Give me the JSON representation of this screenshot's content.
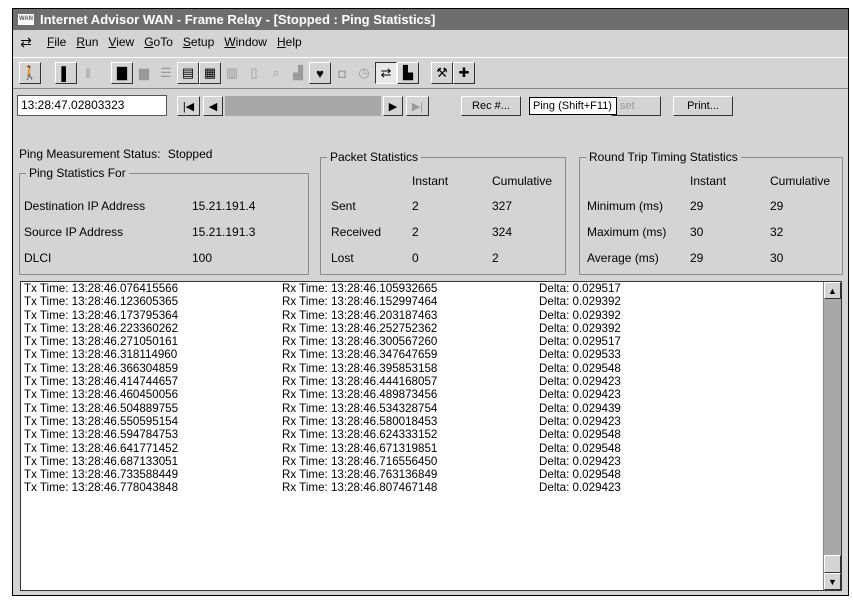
{
  "window": {
    "title": "Internet Advisor WAN - Frame Relay - [Stopped : Ping Statistics]",
    "icon_text": "WAN"
  },
  "menu": [
    "File",
    "Run",
    "View",
    "GoTo",
    "Setup",
    "Window",
    "Help"
  ],
  "toolbar": [
    {
      "icon": "walking-man-icon",
      "glyph": "🚶",
      "state": "on"
    },
    {
      "icon": "info-icon",
      "glyph": "▌",
      "state": "on"
    },
    {
      "icon": "pause-icon",
      "glyph": "‖",
      "state": "off"
    },
    {
      "icon": "bar-chart-icon",
      "glyph": "▇",
      "state": "on"
    },
    {
      "icon": "graph-icon",
      "glyph": "▆",
      "state": "off"
    },
    {
      "icon": "list-icon",
      "glyph": "☰",
      "state": "off"
    },
    {
      "icon": "table-icon",
      "glyph": "▤",
      "state": "on"
    },
    {
      "icon": "grid-icon",
      "glyph": "▦",
      "state": "on"
    },
    {
      "icon": "columns-icon",
      "glyph": "▥",
      "state": "off"
    },
    {
      "icon": "page-icon",
      "glyph": "▯",
      "state": "off"
    },
    {
      "icon": "search-icon",
      "glyph": "⌕",
      "state": "off"
    },
    {
      "icon": "stats-icon",
      "glyph": "▟",
      "state": "off"
    },
    {
      "icon": "heart-icon",
      "glyph": "♥",
      "state": "on"
    },
    {
      "icon": "cup-icon",
      "glyph": "◘",
      "state": "off"
    },
    {
      "icon": "clock-icon",
      "glyph": "◷",
      "state": "off"
    },
    {
      "icon": "ping-icon",
      "glyph": "⇄",
      "state": "pressed"
    },
    {
      "icon": "chart-icon",
      "glyph": "▙",
      "state": "on"
    },
    {
      "icon": "tools-icon",
      "glyph": "⚒",
      "state": "on"
    },
    {
      "icon": "plus-icon",
      "glyph": "✚",
      "state": "on"
    }
  ],
  "nav": {
    "time": "13:28:47.02803323",
    "rec_label": "Rec #...",
    "tooltip": "Ping (Shift+F11)",
    "reset_partial": "set",
    "print_label": "Print..."
  },
  "status": {
    "label": "Ping Measurement Status:",
    "value": "Stopped"
  },
  "ping_for": {
    "title": "Ping Statistics For",
    "rows": [
      {
        "label": "Destination IP Address",
        "value": "15.21.191.4"
      },
      {
        "label": "Source IP Address",
        "value": "15.21.191.3"
      },
      {
        "label": "DLCI",
        "value": "100"
      }
    ]
  },
  "packet_stats": {
    "title": "Packet Statistics",
    "headers": [
      "Instant",
      "Cumulative"
    ],
    "rows": [
      {
        "label": "Sent",
        "instant": "2",
        "cumulative": "327"
      },
      {
        "label": "Received",
        "instant": "2",
        "cumulative": "324"
      },
      {
        "label": "Lost",
        "instant": "0",
        "cumulative": "2"
      }
    ]
  },
  "rtt_stats": {
    "title": "Round Trip Timing Statistics",
    "headers": [
      "Instant",
      "Cumulative"
    ],
    "rows": [
      {
        "label": "Minimum (ms)",
        "instant": "29",
        "cumulative": "29"
      },
      {
        "label": "Maximum (ms)",
        "instant": "30",
        "cumulative": "32"
      },
      {
        "label": "Average (ms)",
        "instant": "29",
        "cumulative": "30"
      }
    ]
  },
  "log": [
    {
      "tx": "Tx Time: 13:28:46.076415566",
      "rx": "Rx Time: 13:28:46.105932665",
      "delta": "Delta: 0.029517"
    },
    {
      "tx": "Tx Time: 13:28:46.123605365",
      "rx": "Rx Time: 13:28:46.152997464",
      "delta": "Delta: 0.029392"
    },
    {
      "tx": "Tx Time: 13:28:46.173795364",
      "rx": "Rx Time: 13:28:46.203187463",
      "delta": "Delta: 0.029392"
    },
    {
      "tx": "Tx Time: 13:28:46.223360262",
      "rx": "Rx Time: 13:28:46.252752362",
      "delta": "Delta: 0.029392"
    },
    {
      "tx": "Tx Time: 13:28:46.271050161",
      "rx": "Rx Time: 13:28:46.300567260",
      "delta": "Delta: 0.029517"
    },
    {
      "tx": "Tx Time: 13:28:46.318114960",
      "rx": "Rx Time: 13:28:46.347647659",
      "delta": "Delta: 0.029533"
    },
    {
      "tx": "Tx Time: 13:28:46.366304859",
      "rx": "Rx Time: 13:28:46.395853158",
      "delta": "Delta: 0.029548"
    },
    {
      "tx": "Tx Time: 13:28:46.414744657",
      "rx": "Rx Time: 13:28:46.444168057",
      "delta": "Delta: 0.029423"
    },
    {
      "tx": "Tx Time: 13:28:46.460450056",
      "rx": "Rx Time: 13:28:46.489873456",
      "delta": "Delta: 0.029423"
    },
    {
      "tx": "Tx Time: 13:28:46.504889755",
      "rx": "Rx Time: 13:28:46.534328754",
      "delta": "Delta: 0.029439"
    },
    {
      "tx": "Tx Time: 13:28:46.550595154",
      "rx": "Rx Time: 13:28:46.580018453",
      "delta": "Delta: 0.029423"
    },
    {
      "tx": "Tx Time: 13:28:46.594784753",
      "rx": "Rx Time: 13:28:46.624333152",
      "delta": "Delta: 0.029548"
    },
    {
      "tx": "Tx Time: 13:28:46.641771452",
      "rx": "Rx Time: 13:28:46.671319851",
      "delta": "Delta: 0.029548"
    },
    {
      "tx": "Tx Time: 13:28:46.687133051",
      "rx": "Rx Time: 13:28:46.716556450",
      "delta": "Delta: 0.029423"
    },
    {
      "tx": "Tx Time: 13:28:46.733588449",
      "rx": "Rx Time: 13:28:46.763136849",
      "delta": "Delta: 0.029548"
    },
    {
      "tx": "Tx Time: 13:28:46.778043848",
      "rx": "Rx Time: 13:28:46.807467148",
      "delta": "Delta: 0.029423"
    }
  ]
}
